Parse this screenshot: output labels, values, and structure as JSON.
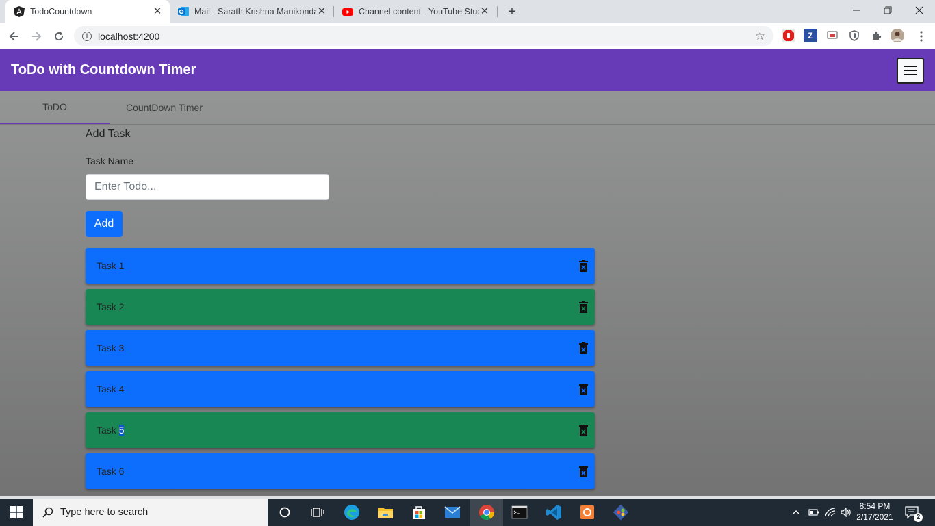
{
  "browser": {
    "tabs": [
      {
        "title": "TodoCountdown",
        "active": true
      },
      {
        "title": "Mail - Sarath Krishna Manikonda",
        "active": false
      },
      {
        "title": "Channel content - YouTube Studio",
        "active": false
      }
    ],
    "url": "localhost:4200"
  },
  "app": {
    "title": "ToDo with Countdown Timer",
    "tabs": [
      {
        "label": "ToDO",
        "active": true
      },
      {
        "label": "CountDown Timer",
        "active": false
      }
    ],
    "form": {
      "heading": "Add Task",
      "field_label": "Task Name",
      "placeholder": "Enter Todo...",
      "add_label": "Add"
    },
    "tasks": [
      {
        "name": "Task 1",
        "color": "#0d6efd"
      },
      {
        "name": "Task 2",
        "color": "#198754"
      },
      {
        "name": "Task 3",
        "color": "#0d6efd"
      },
      {
        "name": "Task 4",
        "color": "#0d6efd"
      },
      {
        "name_prefix": "Task ",
        "name_selected": "5",
        "color": "#198754"
      },
      {
        "name": "Task 6",
        "color": "#0d6efd"
      }
    ],
    "accent": "#673ab7"
  },
  "taskbar": {
    "search_placeholder": "Type here to search",
    "time": "8:54 PM",
    "date": "2/17/2021",
    "notification_count": "2"
  }
}
